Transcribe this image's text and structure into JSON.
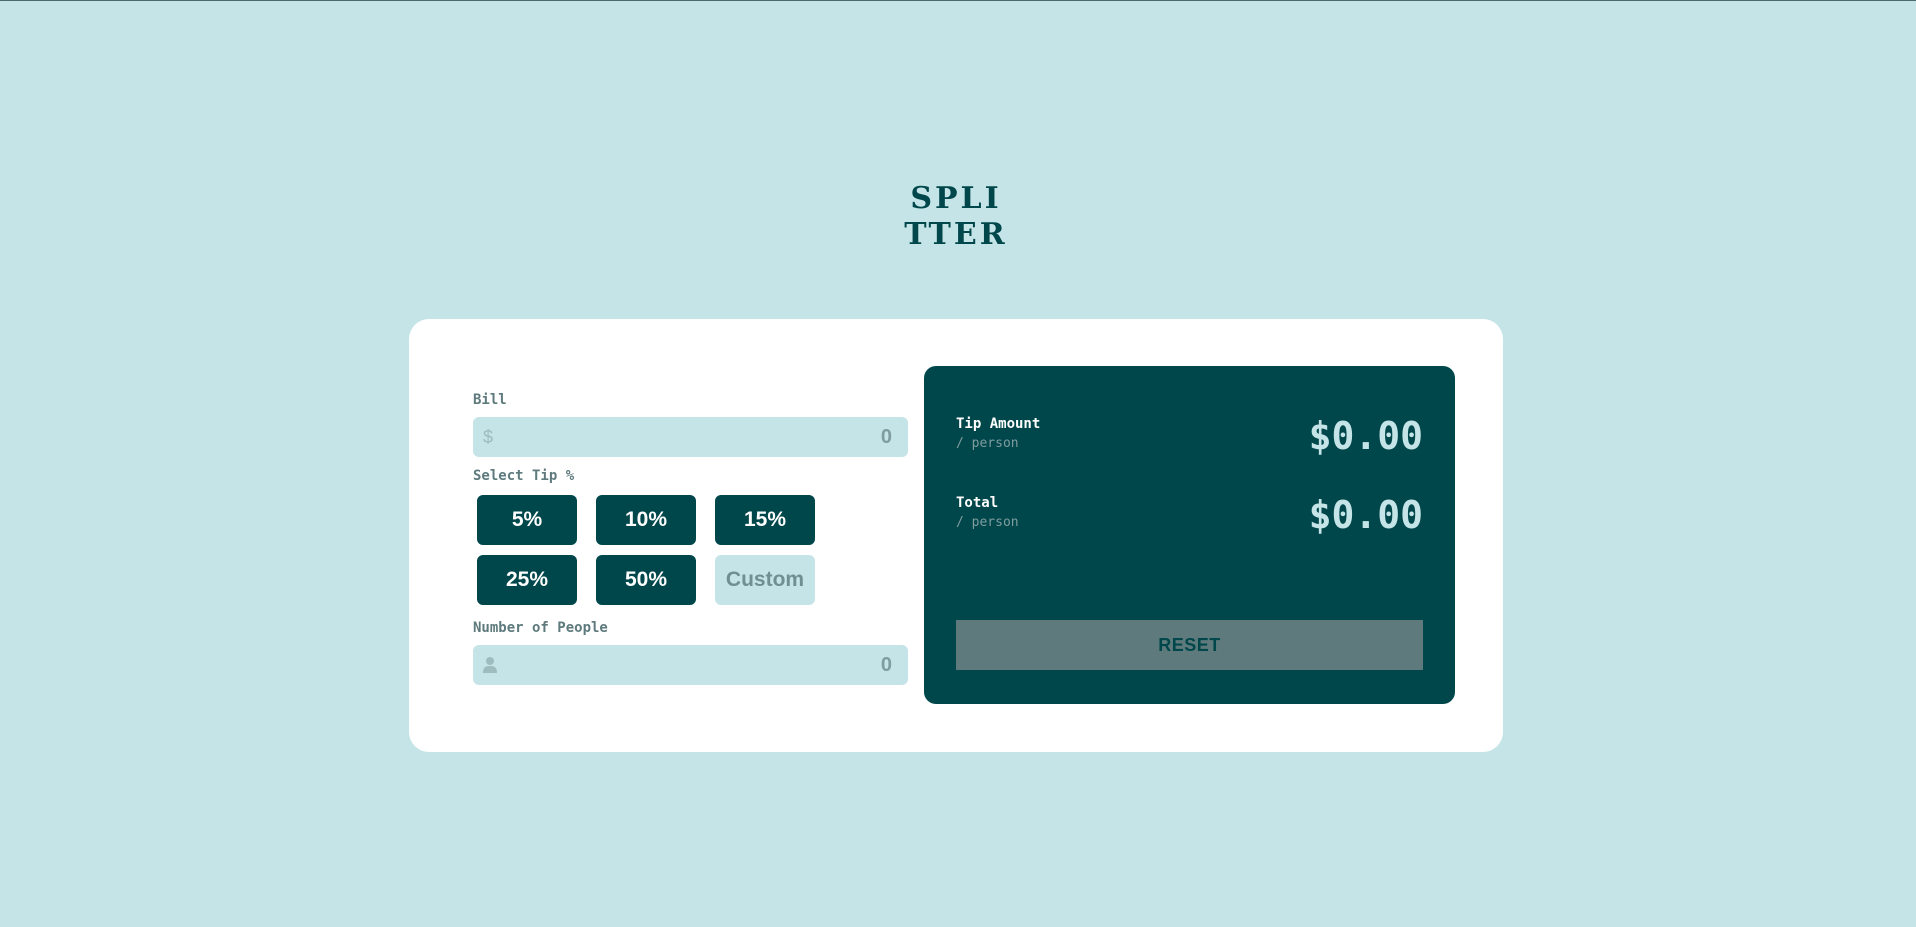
{
  "app": {
    "logo_line1": "SPLI",
    "logo_line2": "TTER"
  },
  "bill": {
    "label": "Bill",
    "prefix": "$",
    "placeholder": "0"
  },
  "tip": {
    "label": "Select Tip %",
    "options": [
      "5%",
      "10%",
      "15%",
      "25%",
      "50%"
    ],
    "custom_placeholder": "Custom"
  },
  "people": {
    "label": "Number of People",
    "icon": "person-icon",
    "placeholder": "0"
  },
  "results": {
    "tip_amount": {
      "title": "Tip Amount",
      "sub": "/ person",
      "value": "$0.00"
    },
    "total": {
      "title": "Total",
      "sub": "/ person",
      "value": "$0.00"
    },
    "reset_label": "RESET"
  },
  "colors": {
    "background": "#c5e4e7",
    "primary": "#00474b",
    "muted": "#5e7a7d",
    "card": "#ffffff"
  }
}
